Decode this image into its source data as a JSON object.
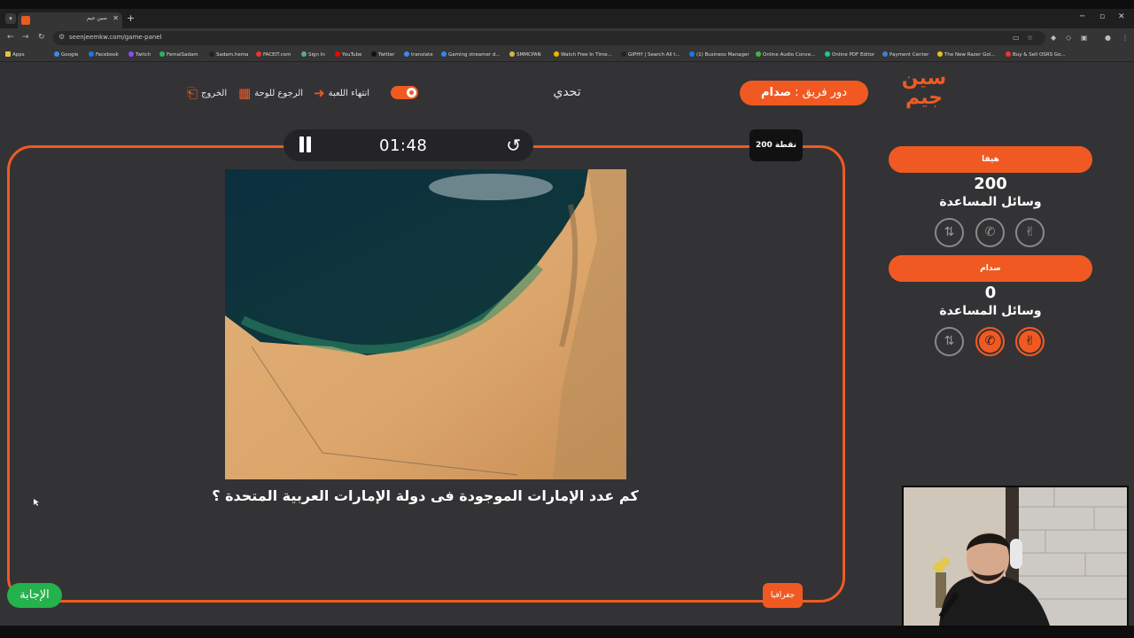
{
  "browser": {
    "tab_title": "سين جيم",
    "url": "seenjeemkw.com/game-panel",
    "bookmarks": [
      "Apps",
      "Google",
      "Facebook",
      "Twitch",
      "FemaiSadam",
      "Sadam.hema",
      "FACEIT.com",
      "Sign In",
      "YouTube",
      "Twitter",
      "translate",
      "Gaming streamer d...",
      "SMMCPAN",
      "Watch Free In Time...",
      "GIPHY | Search All t...",
      "(1) Business Manager",
      "Online Audio Conve...",
      "Online PDF Editor",
      "Payment Center",
      "The New Razer Gol...",
      "Buy & Sell OSRS Go..."
    ]
  },
  "header": {
    "logo_text": "سين جيم",
    "turn_label": "دور فريق :",
    "turn_team": "صدام",
    "mode": "تحدي",
    "end_game": "انتهاء اللعبة",
    "back_to_board": "الرجوع للوحة",
    "exit": "الخروج"
  },
  "timer": {
    "time": "01:48"
  },
  "question": {
    "points": "200 نقطة",
    "text": "كم عدد الإمارات الموجودة فى دولة الإمارات العربية المتحدة ؟",
    "category": "جغرافيا",
    "answer_button": "الإجابة"
  },
  "teams": [
    {
      "name": "هيفا",
      "score": "200",
      "aids_label": "وسائل المساعدة",
      "aids": [
        "swap-icon",
        "phone-icon",
        "hand-icon"
      ],
      "aids_active": [
        false,
        false,
        false
      ]
    },
    {
      "name": "صدام",
      "score": "0",
      "aids_label": "وسائل المساعدة",
      "aids": [
        "swap-icon",
        "phone-icon",
        "hand-icon"
      ],
      "aids_active": [
        false,
        true,
        true
      ]
    }
  ],
  "colors": {
    "accent": "#f05a22",
    "panel": "#333335",
    "answer": "#25b14b"
  }
}
